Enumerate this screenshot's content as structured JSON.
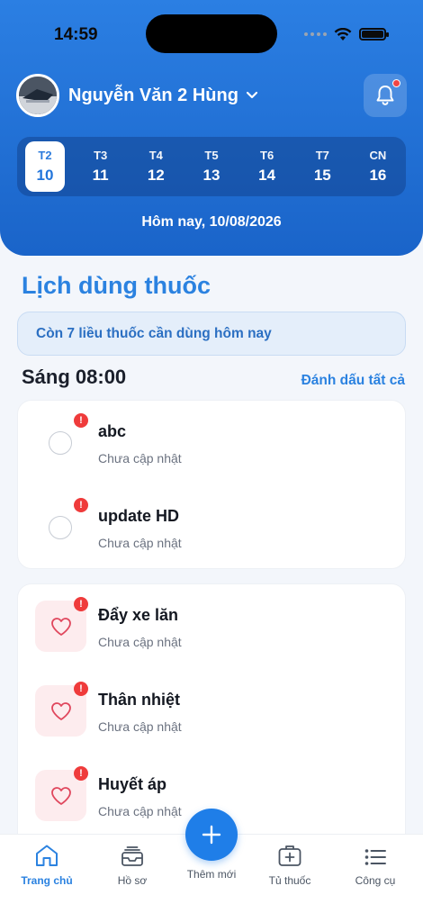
{
  "status_bar": {
    "time": "14:59"
  },
  "header": {
    "user_name": "Nguyễn Văn 2 Hùng",
    "week": [
      {
        "dow": "T2",
        "num": "10",
        "active": true
      },
      {
        "dow": "T3",
        "num": "11"
      },
      {
        "dow": "T4",
        "num": "12"
      },
      {
        "dow": "T5",
        "num": "13"
      },
      {
        "dow": "T6",
        "num": "14"
      },
      {
        "dow": "T7",
        "num": "15"
      },
      {
        "dow": "CN",
        "num": "16"
      }
    ],
    "today_label": "Hôm nay, 10/08/2026"
  },
  "main": {
    "title": "Lịch dùng thuốc",
    "notice": "Còn 7 liều thuốc cần dùng hôm nay",
    "section_time": "Sáng 08:00",
    "mark_all": "Đánh dấu tất cả",
    "medicines": [
      {
        "name": "abc",
        "status": "Chưa cập nhật"
      },
      {
        "name": "update HD",
        "status": "Chưa cập nhật"
      }
    ],
    "health_checks": [
      {
        "name": "Đẩy xe lăn",
        "status": "Chưa cập nhật"
      },
      {
        "name": "Thân nhiệt",
        "status": "Chưa cập nhật"
      },
      {
        "name": "Huyết áp",
        "status": "Chưa cập nhật"
      }
    ],
    "alert_mark": "!"
  },
  "bottom_nav": {
    "home": "Trang chủ",
    "records": "Hồ sơ",
    "add": "Thêm mới",
    "medicine_cabinet": "Tủ thuốc",
    "tools": "Công cụ"
  },
  "colors": {
    "primary": "#2b82e0",
    "alert": "#ef3b3b",
    "heart_bg": "#fdecee"
  }
}
